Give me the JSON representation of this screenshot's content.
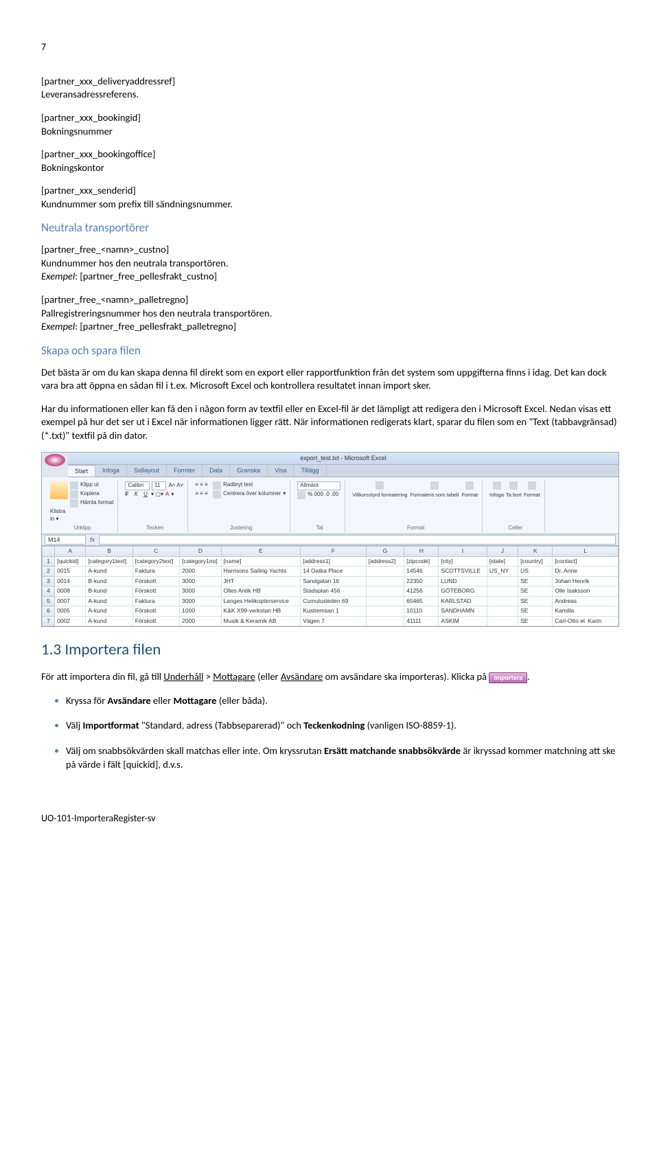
{
  "page_number": "7",
  "fields": {
    "f1_tag": "[partner_xxx_deliveryaddressref]",
    "f1_desc": "Leveransadressreferens.",
    "f2_tag": "[partner_xxx_bookingid]",
    "f2_desc": "Bokningsnummer",
    "f3_tag": "[partner_xxx_bookingoffice]",
    "f3_desc": "Bokningskontor",
    "f4_tag": "[partner_xxx_senderid]",
    "f4_desc": "Kundnummer som prefix till sändningsnummer."
  },
  "sec_neutral": {
    "heading": "Neutrala transportörer",
    "f5_tag": "[partner_free_<namn>_custno]",
    "f5_desc": "Kundnummer hos den neutrala transportören.",
    "f5_ex_label": "Exempel",
    "f5_ex_val": ": [partner_free_pellesfrakt_custno]",
    "f6_tag": "[partner_free_<namn>_palletregno]",
    "f6_desc": "Pallregistreringsnummer hos den neutrala transportören.",
    "f6_ex_label": "Exempel",
    "f6_ex_val": ": [partner_free_pellesfrakt_palletregno]"
  },
  "sec_skapa": {
    "heading": "Skapa och spara filen",
    "p1": "Det bästa är om du kan skapa denna fil direkt som en export eller rapportfunktion från det system som uppgifterna finns i idag. Det kan dock vara bra att öppna en sådan fil i t.ex. Microsoft Excel och kontrollera resultatet innan import sker.",
    "p2": "Har du informationen eller kan få den i någon form av textfil eller en Excel-fil är det lämpligt att redigera den i Microsoft Excel. Nedan visas ett exempel på hur det ser ut i Excel när informationen ligger rätt. När informationen redigerats klart, sparar du filen som en \"Text (tabbavgränsad) (*.txt)\" textfil på din dator."
  },
  "excel": {
    "title": "export_test.txt - Microsoft Excel",
    "tabs": [
      "Start",
      "Infoga",
      "Sidlayout",
      "Formler",
      "Data",
      "Granska",
      "Visa",
      "Tillägg"
    ],
    "clip": {
      "cut": "Klipp ut",
      "copy": "Kopiera",
      "fmt": "Hämta format",
      "group": "Urklipp"
    },
    "font_name": "Calibri",
    "font_size": "11",
    "font_group": "Tecken",
    "align": {
      "wrap": "Radbryt text",
      "merge": "Centrera över kolumner",
      "group": "Justering"
    },
    "number": {
      "general": "Allmänt",
      "group": "Tal"
    },
    "styles": {
      "cond": "Villkorsstyrd formatering",
      "tbl": "Formatera som tabell",
      "cell": "Format",
      "group": "Format"
    },
    "cells": {
      "ins": "Infoga",
      "del": "Ta bort",
      "fmt": "Format",
      "group": "Celler"
    },
    "addr": "M14",
    "cols": [
      "A",
      "B",
      "C",
      "D",
      "E",
      "F",
      "G",
      "H",
      "I",
      "J",
      "K",
      "L"
    ],
    "rows": [
      [
        "[quickid]",
        "[category1text]",
        "[category2text]",
        "[category1no]",
        "[name]",
        "[address1]",
        "[address2]",
        "[zipcode]",
        "[city]",
        "[state]",
        "[country]",
        "[contact]"
      ],
      [
        "0015",
        "A-kund",
        "Faktura",
        "2000",
        "Harrisons Sailing Yachts",
        "14 Oatka Place",
        "",
        "14546",
        "SCOTTSVILLE",
        "US_NY",
        "US",
        "Dr. Anne"
      ],
      [
        "0014",
        "B-kund",
        "Förskott",
        "3000",
        "JHT",
        "Sandgatan 16",
        "",
        "22350",
        "LUND",
        "",
        "SE",
        "Johan Henrik"
      ],
      [
        "0008",
        "B-kund",
        "Förskott",
        "3000",
        "Olles Antik HB",
        "Stadsplan 456",
        "",
        "41256",
        "GÖTEBORG",
        "",
        "SE",
        "Olle Isaksson"
      ],
      [
        "0007",
        "A-kund",
        "Faktura",
        "3000",
        "Langes Helikopterservice",
        "Cumulusleden 69",
        "",
        "65465",
        "KARLSTAD",
        "",
        "SE",
        "Andreas"
      ],
      [
        "0005",
        "A-kund",
        "Förskott",
        "1000",
        "K&K X99-verkstan HB",
        "Kustremsan 1",
        "",
        "10110",
        "SANDHAMN",
        "",
        "SE",
        "Kamilla"
      ],
      [
        "0002",
        "A-kund",
        "Förskott",
        "2000",
        "Musik & Keramik AB",
        "Vägen 7",
        "",
        "41111",
        "ASKIM",
        "",
        "SE",
        "Carl-Otto el. Karin"
      ]
    ]
  },
  "sec_import": {
    "heading": "1.3  Importera filen",
    "p_pre": "För att importera din fil, gå till ",
    "p_underhall": "Underhåll",
    "p_gt1": " > ",
    "p_mottagare": "Mottagare",
    "p_mid": " (eller ",
    "p_avsandare": "Avsändare",
    "p_mid2": " om avsändare ska importeras). Klicka på ",
    "btn_label": "Importera",
    "p_end": ".",
    "b1_pre": "Kryssa för ",
    "b1_av": "Avsändare",
    "b1_or": " eller ",
    "b1_mo": "Mottagare",
    "b1_post": " (eller båda).",
    "b2_pre": "Välj ",
    "b2_if": "Importformat",
    "b2_mid": " \"Standard, adress (Tabbseparerad)\" och ",
    "b2_tk": "Teckenkodning",
    "b2_post": " (vanligen ISO-8859-1).",
    "b3_pre": "Välj om snabbsökvärden skall matchas eller inte. Om kryssrutan ",
    "b3_em": "Ersätt matchande snabbsökvärde",
    "b3_post": " är ikryssad kommer matchning att ske på värde i fält [quickid], d.v.s."
  },
  "footer": "UO-101-ImporteraRegister-sv"
}
